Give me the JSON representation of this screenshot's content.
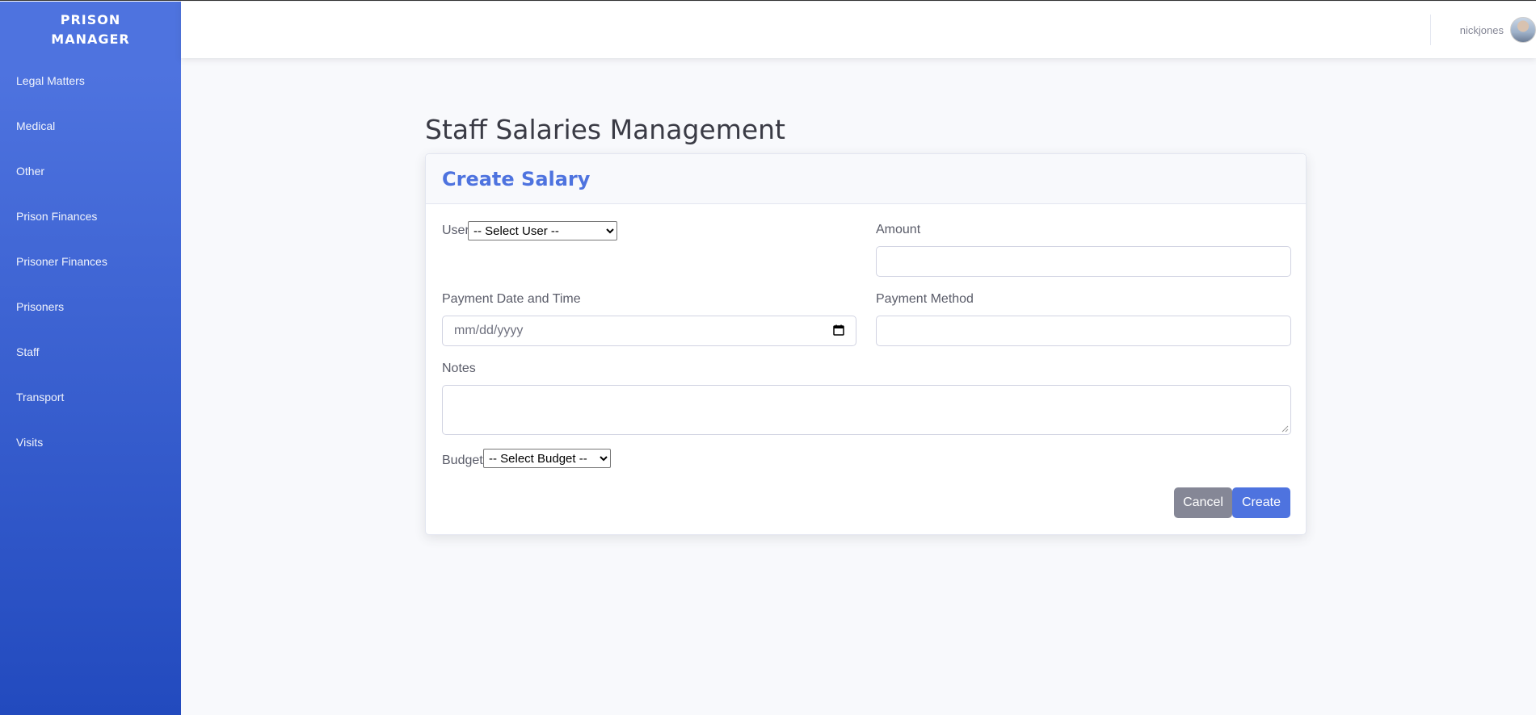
{
  "app": {
    "brand": "PRISON MANAGER"
  },
  "sidebar": {
    "items": [
      {
        "label": "Legal Matters"
      },
      {
        "label": "Medical"
      },
      {
        "label": "Other"
      },
      {
        "label": "Prison Finances"
      },
      {
        "label": "Prisoner Finances"
      },
      {
        "label": "Prisoners"
      },
      {
        "label": "Staff"
      },
      {
        "label": "Transport"
      },
      {
        "label": "Visits"
      }
    ]
  },
  "topbar": {
    "username": "nickjones",
    "avatar_icon": "user-avatar-icon"
  },
  "page": {
    "title": "Staff Salaries Management"
  },
  "form": {
    "title": "Create Salary",
    "user": {
      "label": "User",
      "selected": "-- Select User --"
    },
    "amount": {
      "label": "Amount",
      "value": ""
    },
    "payment_date": {
      "label": "Payment Date and Time",
      "placeholder": "mm/dd/yyyy"
    },
    "payment_method": {
      "label": "Payment Method",
      "value": ""
    },
    "notes": {
      "label": "Notes",
      "value": ""
    },
    "budget": {
      "label": "Budget",
      "selected": "-- Select Budget --"
    },
    "cancel_label": "Cancel",
    "create_label": "Create"
  },
  "colors": {
    "primary": "#4e73df",
    "secondary": "#858796",
    "sidebar_top": "#4e73df",
    "sidebar_bottom": "#224abe"
  }
}
